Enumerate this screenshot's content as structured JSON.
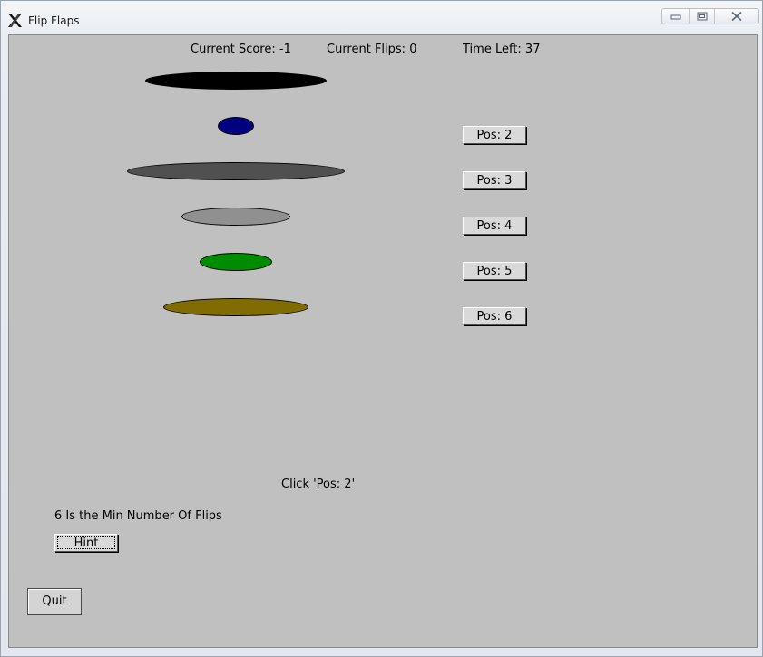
{
  "window": {
    "title": "Flip Flaps",
    "icon": "x-app-icon",
    "controls": [
      "minimize-icon",
      "maximize-icon",
      "close-icon"
    ]
  },
  "status": {
    "score": "Current Score: -1",
    "flips": "Current Flips: 0",
    "time_left": "Time Left: 37"
  },
  "flaps": [
    {
      "position": 1,
      "color": "#000000"
    },
    {
      "position": 2,
      "color": "#000080"
    },
    {
      "position": 3,
      "color": "#505050"
    },
    {
      "position": 4,
      "color": "#909090"
    },
    {
      "position": 5,
      "color": "#008c00"
    },
    {
      "position": 6,
      "color": "#806c00"
    }
  ],
  "buttons": {
    "pos2": "Pos: 2",
    "pos3": "Pos: 3",
    "pos4": "Pos: 4",
    "pos5": "Pos: 5",
    "pos6": "Pos: 6",
    "hint": "Hint",
    "quit": "Quit"
  },
  "messages": {
    "instruction": "Click 'Pos: 2'",
    "min_flips": "6 Is the Min Number Of Flips"
  }
}
